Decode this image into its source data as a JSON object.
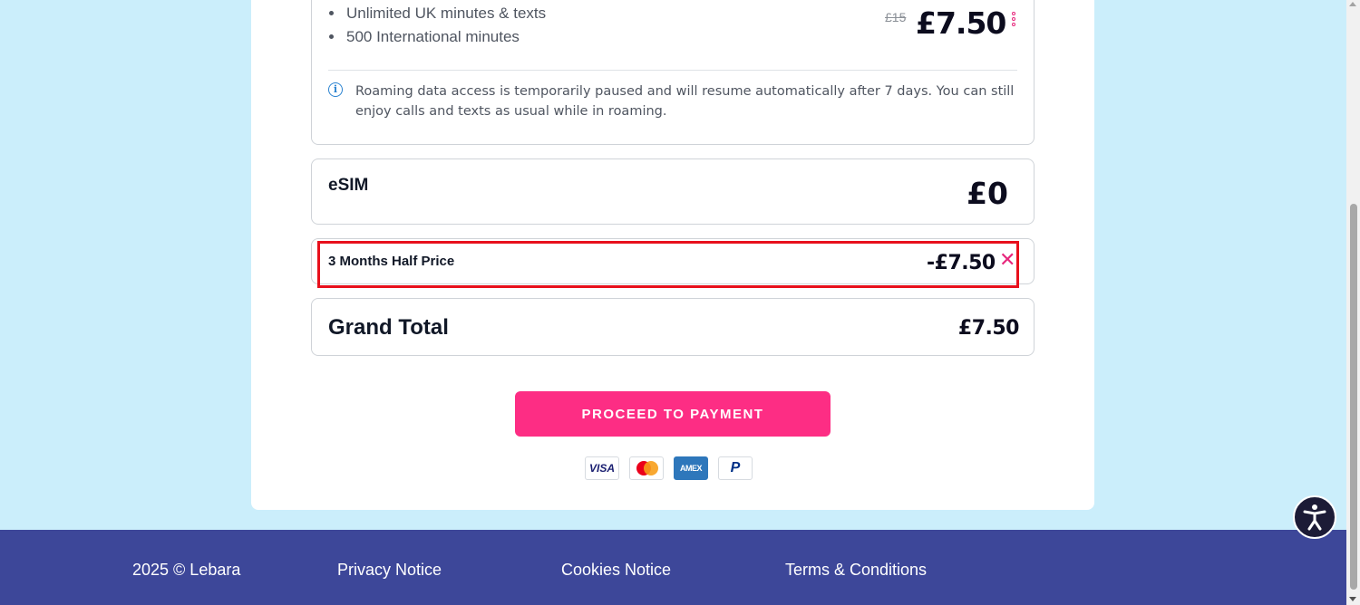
{
  "plan": {
    "features": [
      "Unlimited UK minutes & texts",
      "500 International minutes"
    ],
    "old_price": "£15",
    "new_price": "£7.50",
    "info_text": "Roaming data access is temporarily paused and will resume automatically after 7 days. You can still enjoy calls and texts as usual while in roaming."
  },
  "esim": {
    "label": "eSIM",
    "amount": "£0"
  },
  "discount": {
    "label": "3 Months Half Price",
    "amount": "-£7.50",
    "remove_icon": "close-icon"
  },
  "grand_total": {
    "label": "Grand Total",
    "amount": "£7.50"
  },
  "actions": {
    "proceed_label": "PROCEED TO PAYMENT"
  },
  "payment_methods": [
    {
      "name": "visa",
      "label": "VISA"
    },
    {
      "name": "mastercard",
      "label": ""
    },
    {
      "name": "amex",
      "label": "AMEX"
    },
    {
      "name": "paypal",
      "label": "P"
    }
  ],
  "footer": {
    "copyright": "2025 © Lebara",
    "links": [
      "Privacy Notice",
      "Cookies Notice",
      "Terms & Conditions"
    ]
  },
  "colors": {
    "accent_pink": "#fd2d84",
    "footer_bg": "#3d4799",
    "page_bg": "#cbeefb",
    "highlight_red": "#e8101c"
  }
}
